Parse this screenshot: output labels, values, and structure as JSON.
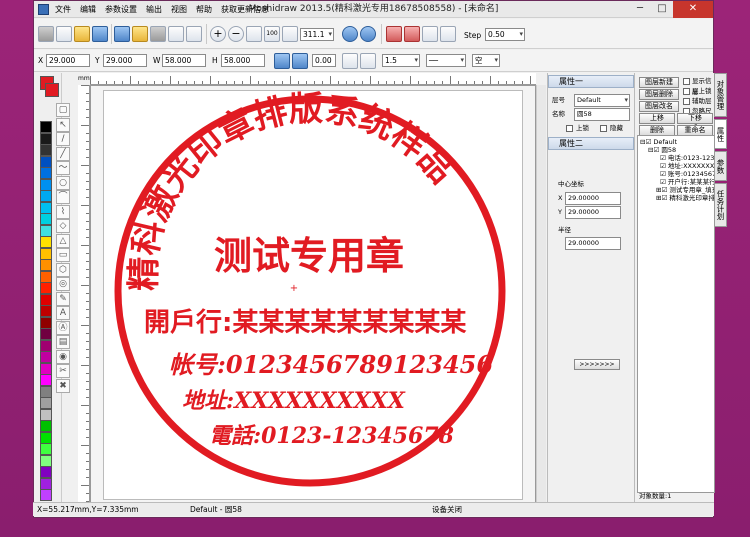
{
  "window": {
    "title": "Moshidraw 2013.5(精科激光专用18678508558) - [未命名]",
    "min": "─",
    "max": "□",
    "close": "✕"
  },
  "menu": [
    "文件",
    "编辑",
    "参数设置",
    "输出",
    "视图",
    "帮助",
    "获取更新信息"
  ],
  "toolbar1": {
    "zoom_value": "311.1",
    "step_label": "Step",
    "step_value": "0.50",
    "size_btn": "100"
  },
  "toolbar2": {
    "x_label": "X",
    "x_value": "29.000",
    "y_label": "Y",
    "y_value": "29.000",
    "w_label": "W",
    "w_value": "58.000",
    "h_label": "H",
    "h_value": "58.000",
    "rot_value": "0.00",
    "line_value": "1.5",
    "fill_value": "空"
  },
  "rulers": {
    "unit": "mm"
  },
  "props": {
    "panel1_title": "属性一",
    "layer_label": "层号",
    "layer_value": "Default",
    "name_label": "名称",
    "name_value": "圆58",
    "lock_label": "上锁",
    "hide_label": "隐藏",
    "panel2_title": "属性二",
    "center_label": "中心坐标",
    "cx_label": "X",
    "cx_value": "29.00000",
    "cy_label": "Y",
    "cy_value": "29.00000",
    "radius_label": "半径",
    "radius_value": "29.00000",
    "apply_btn": ">>>>>>>"
  },
  "layers": {
    "btn_new": "图层新建",
    "btn_delete": "图层删除",
    "btn_rename": "图层改名",
    "btn_up": "上移",
    "btn_down": "下移",
    "btn_del": "删除",
    "btn_rename2": "重命名",
    "chk1": "显示信息",
    "chk2": "层上锁",
    "chk3": "辅助层",
    "chk4": "忽略尺寸",
    "tree": [
      "Default",
      "圆58",
      "电话:0123-123",
      "地址:XXXXXXXX",
      "账号:01234567",
      "开户行:某某某行",
      "测试专用章_填充",
      "精科激光印章排版"
    ],
    "count_label": "对象数量:",
    "count_value": "1"
  },
  "vtabs": [
    "对象管理",
    "属性",
    "参数",
    "任务计划"
  ],
  "stamp": {
    "arc_text": "精科激光印章排版系统样品",
    "center_text": "测试专用章",
    "lines": [
      "開戶行:某某某某某某某某某",
      "帐号:0123456789123456",
      "地址:XXXXXXXXXX",
      "電話:0123-12345678"
    ]
  },
  "status": {
    "coords": "X=55.217mm,Y=7.335mm",
    "layer": "Default - 圆58",
    "device": "设备关闭"
  },
  "colors": {
    "stamp_red": "#e11b22",
    "title_close": "#c7352c"
  }
}
